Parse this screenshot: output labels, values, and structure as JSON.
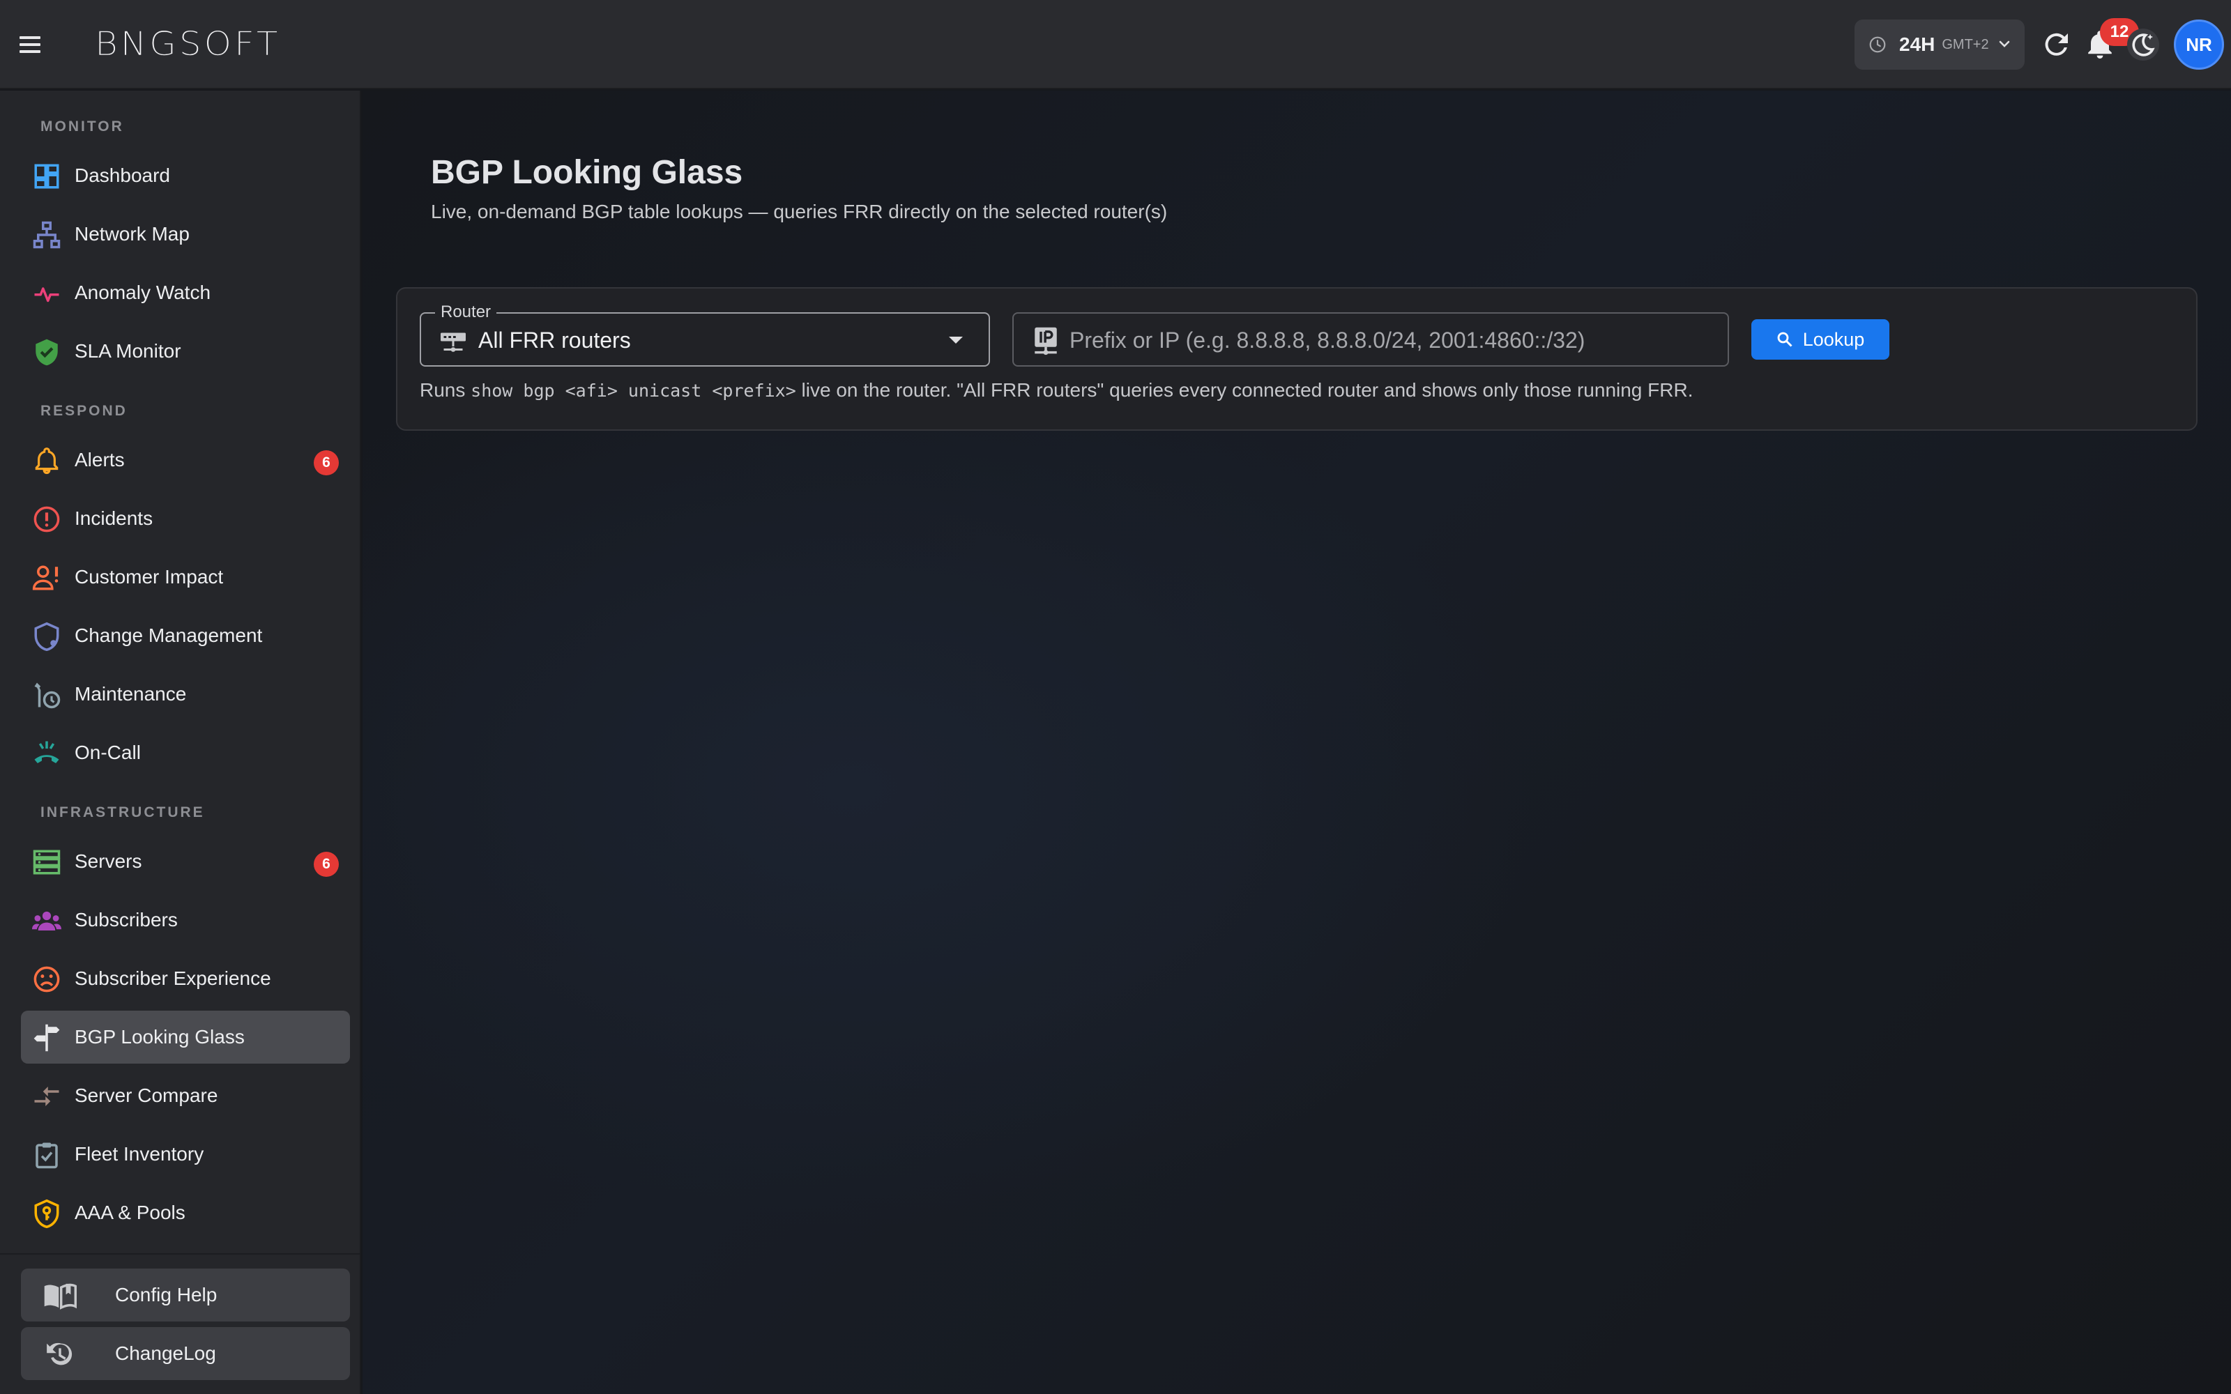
{
  "app": {
    "brand": "BNGSOFT"
  },
  "topbar": {
    "time_range": "24H",
    "timezone": "GMT+2",
    "notification_count": "12",
    "user_initials": "NR"
  },
  "sidebar": {
    "sections": [
      {
        "heading": "MONITOR"
      },
      {
        "heading": "RESPOND"
      },
      {
        "heading": "INFRASTRUCTURE"
      }
    ],
    "items": [
      {
        "label": "Dashboard",
        "icon": "dashboard-icon",
        "color": "#42a5f5"
      },
      {
        "label": "Network Map",
        "icon": "network-tree-icon",
        "color": "#7986cb"
      },
      {
        "label": "Anomaly Watch",
        "icon": "pulse-icon",
        "color": "#ec407a"
      },
      {
        "label": "SLA Monitor",
        "icon": "shield-check-icon",
        "color": "#43a047"
      },
      {
        "label": "Alerts",
        "icon": "bell-icon",
        "color": "#ffa726",
        "badge": "6"
      },
      {
        "label": "Incidents",
        "icon": "alert-circle-icon",
        "color": "#ef5350"
      },
      {
        "label": "Customer Impact",
        "icon": "person-alert-icon",
        "color": "#ff7043"
      },
      {
        "label": "Change Management",
        "icon": "policy-shield-icon",
        "color": "#7986cb"
      },
      {
        "label": "Maintenance",
        "icon": "wrench-clock-icon",
        "color": "#90a4ae"
      },
      {
        "label": "On-Call",
        "icon": "phone-callback-icon",
        "color": "#26a69a"
      },
      {
        "label": "Servers",
        "icon": "server-icon",
        "color": "#66bb6a",
        "badge": "6"
      },
      {
        "label": "Subscribers",
        "icon": "people-icon",
        "color": "#ab47bc"
      },
      {
        "label": "Subscriber Experience",
        "icon": "sad-face-icon",
        "color": "#ff7043"
      },
      {
        "label": "BGP Looking Glass",
        "icon": "signpost-icon",
        "color": "#e0e0e0",
        "active": true
      },
      {
        "label": "Server Compare",
        "icon": "compare-arrows-icon",
        "color": "#a1887f"
      },
      {
        "label": "Fleet Inventory",
        "icon": "clipboard-check-icon",
        "color": "#90a4ae"
      },
      {
        "label": "AAA & Pools",
        "icon": "shield-key-icon",
        "color": "#ffb300"
      }
    ],
    "footer": [
      {
        "label": "Config Help",
        "icon": "book-open-icon"
      },
      {
        "label": "ChangeLog",
        "icon": "history-icon"
      }
    ]
  },
  "main": {
    "title": "BGP Looking Glass",
    "subtitle": "Live, on-demand BGP table lookups — queries FRR directly on the selected router(s)",
    "router_field": {
      "label": "Router",
      "value": "All FRR routers"
    },
    "prefix_field": {
      "placeholder": "Prefix or IP (e.g. 8.8.8.8, 8.8.8.0/24, 2001:4860::/32)",
      "value": ""
    },
    "lookup_button": "Lookup",
    "hint": {
      "prefix": "Runs",
      "command": "show bgp <afi> unicast <prefix>",
      "suffix": "live on the router. \"All FRR routers\" queries every connected router and shows only those running FRR."
    }
  },
  "colors": {
    "accent": "#1977ee",
    "badge": "#e53935",
    "avatar": "#1e6ef0"
  }
}
